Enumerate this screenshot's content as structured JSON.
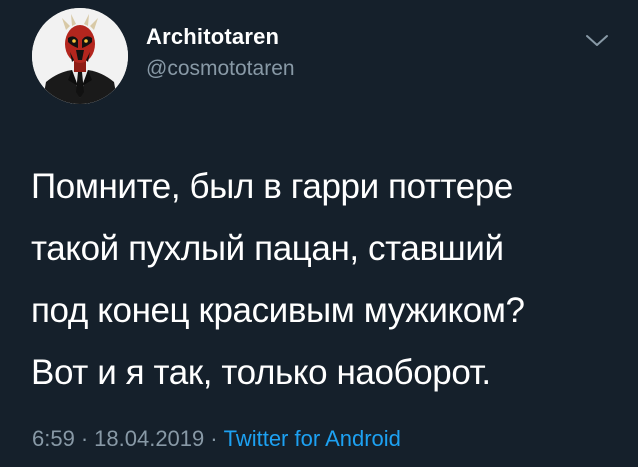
{
  "author": {
    "display_name": "Architotaren",
    "handle": "@cosmototaren",
    "avatar_icon": "darth-maul-avatar-icon"
  },
  "menu": {
    "icon": "chevron-down-icon"
  },
  "tweet": {
    "lines": [
      "Помните, был в гарри поттере",
      "такой пухлый пацан, ставший",
      "под конец красивым мужиком?",
      "Вот и я так, только наоборот."
    ]
  },
  "meta": {
    "time": "6:59",
    "separator": "·",
    "date": "18.04.2019",
    "source": "Twitter for Android"
  },
  "colors": {
    "background": "#15202b",
    "text_primary": "#ffffff",
    "text_secondary": "#8899a6",
    "accent": "#1da1f2"
  }
}
